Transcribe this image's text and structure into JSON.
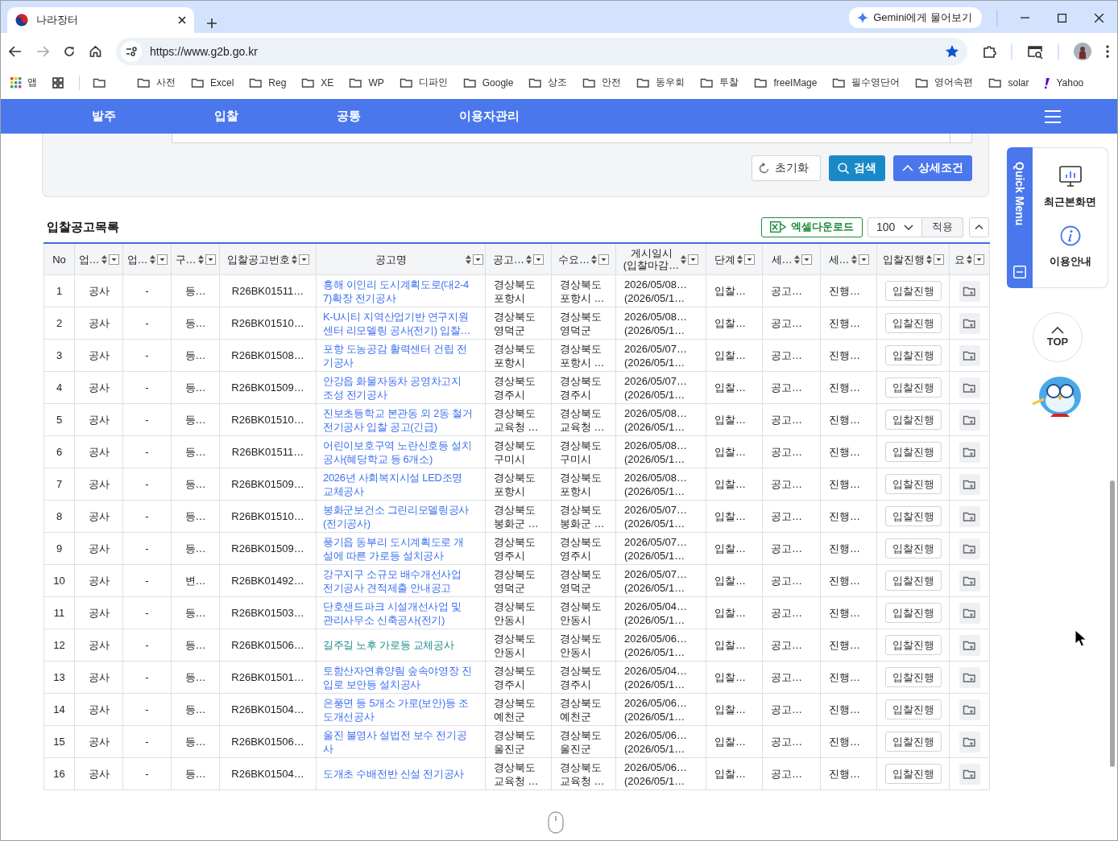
{
  "browser": {
    "tab_title": "나라장터",
    "gemini": "Gemini에게 물어보기",
    "url": "https://www.g2b.go.kr",
    "bookmarked": true,
    "bookmarks": [
      {
        "kind": "apps",
        "label": "앱"
      },
      {
        "kind": "grid"
      },
      {
        "kind": "folder"
      },
      {
        "kind": "folder",
        "label": "사전"
      },
      {
        "kind": "folder",
        "label": "Excel"
      },
      {
        "kind": "folder",
        "label": "Reg"
      },
      {
        "kind": "folder",
        "label": "XE"
      },
      {
        "kind": "folder",
        "label": "WP"
      },
      {
        "kind": "folder",
        "label": "디파인"
      },
      {
        "kind": "folder",
        "label": "Google"
      },
      {
        "kind": "folder",
        "label": "상조"
      },
      {
        "kind": "folder",
        "label": "안전"
      },
      {
        "kind": "folder",
        "label": "동우회"
      },
      {
        "kind": "folder",
        "label": "투찰"
      },
      {
        "kind": "folder",
        "label": "freeIMage"
      },
      {
        "kind": "folder",
        "label": "필수영단어"
      },
      {
        "kind": "folder",
        "label": "영어속편"
      },
      {
        "kind": "folder",
        "label": "solar"
      },
      {
        "kind": "yahoo",
        "label": "Yahoo"
      }
    ]
  },
  "nav": {
    "menus": [
      "발주",
      "입찰",
      "공통",
      "이용자관리"
    ]
  },
  "filter": {
    "buttons": [
      {
        "kind": "reset",
        "label": "초기화"
      },
      {
        "kind": "search",
        "label": "검색"
      },
      {
        "kind": "detail",
        "label": "상세조건"
      }
    ]
  },
  "list": {
    "title": "입찰공고목록",
    "excel": "엑셀다운로드",
    "page_size": "100",
    "apply": "적용"
  },
  "table": {
    "columns": [
      {
        "label": "No",
        "sortable": false
      },
      {
        "label": "업…",
        "sortable": true
      },
      {
        "label": "업…",
        "sortable": true
      },
      {
        "label": "구…",
        "sortable": true
      },
      {
        "label": "입찰공고번호",
        "sortable": true
      },
      {
        "label": "공고명",
        "sortable": true
      },
      {
        "label": "공고…",
        "sortable": true
      },
      {
        "label": "수요…",
        "sortable": true
      },
      {
        "label": "게시일시\n(입찰마감…",
        "sortable": true
      },
      {
        "label": "단계",
        "sortable": true
      },
      {
        "label": "세…",
        "sortable": true
      },
      {
        "label": "세…",
        "sortable": true
      },
      {
        "label": "입찰진행",
        "sortable": true
      },
      {
        "label": "요",
        "sortable": true
      }
    ],
    "rows": [
      {
        "no": "1",
        "col_2": "공사",
        "col_3": "-",
        "col_4": "등…",
        "bid_no": "R26BK01511…",
        "title": "흥해 이인리 도시계획도로(대2-4\n7)확장 전기공사",
        "visited": false,
        "agency": "경상북도\n포항시",
        "demand": "경상북도\n포항시 …",
        "posted": "2026/05/08…\n(2026/05/1…",
        "stage": "입찰…",
        "col_11": "공고…",
        "col_12": "진행…",
        "action": "입찰진행"
      },
      {
        "no": "2",
        "col_2": "공사",
        "col_3": "-",
        "col_4": "등…",
        "bid_no": "R26BK01510…",
        "title": "K-U시티 지역산업기반 연구지원\n센터 리모델링 공사(전기) 입찰…",
        "visited": false,
        "agency": "경상북도\n영덕군",
        "demand": "경상북도\n영덕군",
        "posted": "2026/05/08…\n(2026/05/1…",
        "stage": "입찰…",
        "col_11": "공고…",
        "col_12": "진행…",
        "action": "입찰진행"
      },
      {
        "no": "3",
        "col_2": "공사",
        "col_3": "-",
        "col_4": "등…",
        "bid_no": "R26BK01508…",
        "title": "포항 도농공감 활력센터 건립 전\n기공사",
        "visited": false,
        "agency": "경상북도\n포항시",
        "demand": "경상북도\n포항시 …",
        "posted": "2026/05/07…\n(2026/05/1…",
        "stage": "입찰…",
        "col_11": "공고…",
        "col_12": "진행…",
        "action": "입찰진행"
      },
      {
        "no": "4",
        "col_2": "공사",
        "col_3": "-",
        "col_4": "등…",
        "bid_no": "R26BK01509…",
        "title": "안강읍 화물자동차 공영차고지\n조성 전기공사",
        "visited": false,
        "agency": "경상북도\n경주시",
        "demand": "경상북도\n경주시",
        "posted": "2026/05/07…\n(2026/05/1…",
        "stage": "입찰…",
        "col_11": "공고…",
        "col_12": "진행…",
        "action": "입찰진행"
      },
      {
        "no": "5",
        "col_2": "공사",
        "col_3": "-",
        "col_4": "등…",
        "bid_no": "R26BK01510…",
        "title": "진보초등학교 본관동 외 2동 철거\n전기공사 입찰 공고(긴급)",
        "visited": false,
        "agency": "경상북도\n교육청 …",
        "demand": "경상북도\n교육청 …",
        "posted": "2026/05/08…\n(2026/05/1…",
        "stage": "입찰…",
        "col_11": "공고…",
        "col_12": "진행…",
        "action": "입찰진행"
      },
      {
        "no": "6",
        "col_2": "공사",
        "col_3": "-",
        "col_4": "등…",
        "bid_no": "R26BK01511…",
        "title": "어린이보호구역 노란신호등 설치\n공사(혜당학교 등 6개소)",
        "visited": false,
        "agency": "경상북도\n구미시",
        "demand": "경상북도\n구미시",
        "posted": "2026/05/08…\n(2026/05/1…",
        "stage": "입찰…",
        "col_11": "공고…",
        "col_12": "진행…",
        "action": "입찰진행"
      },
      {
        "no": "7",
        "col_2": "공사",
        "col_3": "-",
        "col_4": "등…",
        "bid_no": "R26BK01509…",
        "title": "2026년 사회복지시설 LED조명\n교체공사",
        "visited": false,
        "agency": "경상북도\n포항시",
        "demand": "경상북도\n포항시",
        "posted": "2026/05/08…\n(2026/05/1…",
        "stage": "입찰…",
        "col_11": "공고…",
        "col_12": "진행…",
        "action": "입찰진행"
      },
      {
        "no": "8",
        "col_2": "공사",
        "col_3": "-",
        "col_4": "등…",
        "bid_no": "R26BK01510…",
        "title": "봉화군보건소 그린리모델링공사\n(전기공사)",
        "visited": false,
        "agency": "경상북도\n봉화군 …",
        "demand": "경상북도\n봉화군 …",
        "posted": "2026/05/07…\n(2026/05/1…",
        "stage": "입찰…",
        "col_11": "공고…",
        "col_12": "진행…",
        "action": "입찰진행"
      },
      {
        "no": "9",
        "col_2": "공사",
        "col_3": "-",
        "col_4": "등…",
        "bid_no": "R26BK01509…",
        "title": "풍기읍 동부리 도시계획도로 개\n설에 따른 가로등 설치공사",
        "visited": false,
        "agency": "경상북도\n영주시",
        "demand": "경상북도\n영주시",
        "posted": "2026/05/07…\n(2026/05/1…",
        "stage": "입찰…",
        "col_11": "공고…",
        "col_12": "진행…",
        "action": "입찰진행"
      },
      {
        "no": "10",
        "col_2": "공사",
        "col_3": "-",
        "col_4": "변…",
        "bid_no": "R26BK01492…",
        "title": "강구지구 소규모 배수개선사업\n전기공사 견적제출 안내공고",
        "visited": false,
        "agency": "경상북도\n영덕군",
        "demand": "경상북도\n영덕군",
        "posted": "2026/05/07…\n(2026/05/1…",
        "stage": "입찰…",
        "col_11": "공고…",
        "col_12": "진행…",
        "action": "입찰진행"
      },
      {
        "no": "11",
        "col_2": "공사",
        "col_3": "-",
        "col_4": "등…",
        "bid_no": "R26BK01503…",
        "title": "단호샌드파크 시설개선사업 및\n관리사무소 신축공사(전기)",
        "visited": false,
        "agency": "경상북도\n안동시",
        "demand": "경상북도\n안동시",
        "posted": "2026/05/04…\n(2026/05/1…",
        "stage": "입찰…",
        "col_11": "공고…",
        "col_12": "진행…",
        "action": "입찰진행"
      },
      {
        "no": "12",
        "col_2": "공사",
        "col_3": "-",
        "col_4": "등…",
        "bid_no": "R26BK01506…",
        "title": "길주길 노후 가로등 교체공사",
        "visited": true,
        "agency": "경상북도\n안동시",
        "demand": "경상북도\n안동시",
        "posted": "2026/05/06…\n(2026/05/1…",
        "stage": "입찰…",
        "col_11": "공고…",
        "col_12": "진행…",
        "action": "입찰진행"
      },
      {
        "no": "13",
        "col_2": "공사",
        "col_3": "-",
        "col_4": "등…",
        "bid_no": "R26BK01501…",
        "title": "토함산자연휴양림 숲속야영장 진\n입로 보안등 설치공사",
        "visited": false,
        "agency": "경상북도\n경주시",
        "demand": "경상북도\n경주시",
        "posted": "2026/05/04…\n(2026/05/1…",
        "stage": "입찰…",
        "col_11": "공고…",
        "col_12": "진행…",
        "action": "입찰진행"
      },
      {
        "no": "14",
        "col_2": "공사",
        "col_3": "-",
        "col_4": "등…",
        "bid_no": "R26BK01504…",
        "title": "은풍면 등 5개소 가로(보안)등 조\n도개선공사",
        "visited": false,
        "agency": "경상북도\n예천군",
        "demand": "경상북도\n예천군",
        "posted": "2026/05/06…\n(2026/05/1…",
        "stage": "입찰…",
        "col_11": "공고…",
        "col_12": "진행…",
        "action": "입찰진행"
      },
      {
        "no": "15",
        "col_2": "공사",
        "col_3": "-",
        "col_4": "등…",
        "bid_no": "R26BK01506…",
        "title": "울진 불영사 설법전 보수 전기공\n사",
        "visited": false,
        "agency": "경상북도\n울진군",
        "demand": "경상북도\n울진군",
        "posted": "2026/05/06…\n(2026/05/1…",
        "stage": "입찰…",
        "col_11": "공고…",
        "col_12": "진행…",
        "action": "입찰진행"
      },
      {
        "no": "16",
        "col_2": "공사",
        "col_3": "-",
        "col_4": "등…",
        "bid_no": "R26BK01504…",
        "title": "도개초 수배전반 신설 전기공사",
        "visited": false,
        "agency": "경상북도\n교육청 …",
        "demand": "경상북도\n교육청 …",
        "posted": "2026/05/06…\n(2026/05/1…",
        "stage": "입찰…",
        "col_11": "공고…",
        "col_12": "진행…",
        "action": "입찰진행"
      }
    ]
  },
  "quick_menu": {
    "title": "Quick Menu",
    "items": [
      {
        "kind": "recent",
        "label": "최근본화면"
      },
      {
        "kind": "guide",
        "label": "이용안내"
      }
    ],
    "top": "TOP"
  }
}
